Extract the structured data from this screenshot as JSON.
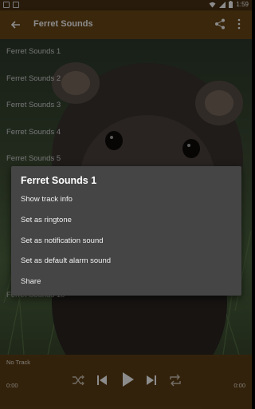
{
  "status_bar": {
    "time": "1:59"
  },
  "app_bar": {
    "title": "Ferret Sounds"
  },
  "list": {
    "items": [
      "Ferret Sounds 1",
      "Ferret Sounds 2",
      "Ferret Sounds 3",
      "Ferret Sounds 4",
      "Ferret Sounds 5",
      "Ferret Sounds 10"
    ]
  },
  "dialog": {
    "title": "Ferret Sounds 1",
    "options": [
      "Show track info",
      "Set as ringtone",
      "Set as notification sound",
      "Set as default alarm sound",
      "Share"
    ]
  },
  "player": {
    "track": "No Track",
    "time_start": "0:00",
    "time_end": "0:00"
  },
  "colors": {
    "app_bar": "#6a4717",
    "status_bar": "#4a3214",
    "player": "#5d3f15",
    "dialog": "#454545"
  }
}
